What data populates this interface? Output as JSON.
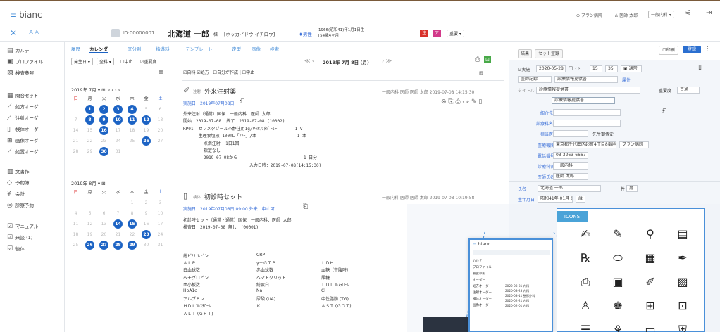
{
  "app": {
    "name": "bianc"
  },
  "topbar": {
    "right_items": [
      "プラン病院",
      "医師 太郎",
      "一般内科"
    ],
    "menu_glyph": "⚟",
    "logout_glyph": "⇥"
  },
  "patient": {
    "id": "ID:00000001",
    "name": "北海道 一郎",
    "honorific": "様",
    "kana": "[ホッカイドウ イチロウ]",
    "sex": "男性",
    "birth": "1966(昭和41)年1月1日生",
    "age": "[54歳4ヶ月]",
    "status": "重要"
  },
  "sidebar": {
    "items": [
      {
        "icon": "▤",
        "label": "カルテ"
      },
      {
        "icon": "▣",
        "label": "プロファイル"
      },
      {
        "icon": "▧",
        "label": "検査参照"
      },
      {
        "icon": "▦",
        "label": "問合セット"
      },
      {
        "icon": "⟋",
        "label": "処方オーダ"
      },
      {
        "icon": "⟋",
        "label": "注射オーダ"
      },
      {
        "icon": "▯",
        "label": "検体オーダ"
      },
      {
        "icon": "⊞",
        "label": "画像オーダ"
      },
      {
        "icon": "⟋",
        "label": "処置オーダ"
      },
      {
        "icon": "▥",
        "label": "文書作"
      },
      {
        "icon": "◇",
        "label": "予約簿"
      },
      {
        "icon": "¥",
        "label": "会計"
      },
      {
        "icon": "◎",
        "label": "診察予約"
      },
      {
        "icon": "☑",
        "label": "マニュアル"
      },
      {
        "icon": "☑",
        "label": "来談 (1)"
      },
      {
        "icon": "☑",
        "label": "後体"
      }
    ]
  },
  "tabs": [
    "履歴",
    "カレンダ",
    "区分別",
    "指導料",
    "テンプレート",
    "定型",
    "画像",
    "検索"
  ],
  "filters": {
    "date_mode": "発生日",
    "dept": "全科",
    "cb1": "中止",
    "cb2": "重要度"
  },
  "calendar": {
    "july_title": "2019年 7月",
    "aug_title": "2019年 8月",
    "weekdays": [
      "日",
      "月",
      "火",
      "水",
      "木",
      "金",
      "土"
    ],
    "july": [
      "",
      "1",
      "2",
      "3",
      "4",
      "5",
      "6",
      "7",
      "8",
      "9",
      "10",
      "11",
      "12",
      "13",
      "14",
      "15",
      "16",
      "17",
      "18",
      "19",
      "20",
      "21",
      "22",
      "23",
      "24",
      "25",
      "26",
      "27",
      "28",
      "29",
      "30",
      "31"
    ],
    "july_selected": [
      "1",
      "2",
      "3",
      "4",
      "8",
      "9",
      "10",
      "11",
      "12",
      "16",
      "26",
      "30"
    ],
    "aug": [
      "",
      "",
      "",
      "",
      "1",
      "2",
      "3",
      "4",
      "5",
      "6",
      "7",
      "8",
      "9",
      "10",
      "11",
      "12",
      "13",
      "14",
      "15",
      "16",
      "17",
      "18",
      "19",
      "20",
      "21",
      "22",
      "23",
      "24",
      "25",
      "26",
      "27",
      "28",
      "29",
      "30",
      "31"
    ],
    "aug_selected": [
      "14",
      "15",
      "23",
      "26",
      "27",
      "28",
      "29"
    ]
  },
  "records_header": {
    "dashes": "- - - - - - - -",
    "date": "2019年 7月 8日 (月)",
    "checks": [
      "自科",
      "処方",
      "自分が作成",
      "中止"
    ]
  },
  "record1": {
    "title": "外来注射薬",
    "title_prefix": "注射",
    "meta": "一般内科 医師 医師 太郎 2019-07-08 14:15:30",
    "impl": "実施日：2019年07月08日",
    "lines": [
      "外来注射（通常）国保　一般内科：医師 太郎",
      "開始：2019-07-08  終了：2019-07-08 (10002)",
      "RP01  セフメタゾール※静注用1g/V<ｾﾌﾒﾀｿﾞｰﾙ>       1 V",
      "      生理食塩液 100mL「ﾌｿｰ」/本                1 本",
      "        点滴注射  1日1回",
      "        指定なし",
      "        2019-07-08から                          1 日分",
      "                          入力日時：2019-07-08(14:15:30)"
    ]
  },
  "record2": {
    "title": "初診時セット",
    "title_prefix": "検体",
    "meta": "一般内科 医師 医師 太郎 2019-07-08 10:19:58",
    "impl": "実施日：2019年07月08日 09:00 外来：中止可",
    "lines": [
      "初診時セット（通常・通常）国保　一般内科：医師 太郎",
      "検査日：2019-07-08 無し　(00001)"
    ],
    "table": [
      [
        "総ビリルビン",
        "CRP",
        ""
      ],
      [
        "ＡＬＰ",
        "γ－ＧＴＰ",
        "ＬＤＨ"
      ],
      [
        "白血球数",
        "赤血球数",
        "血糖（空腹時）"
      ],
      [
        "ヘモグロビン",
        "ヘマトクリット",
        "尿糖"
      ],
      [
        "血小板数",
        "総蛋白",
        "ＬＤＬｺﾚｽﾃﾛｰﾙ"
      ],
      [
        "HbA1c",
        "Na",
        "Cl"
      ],
      [
        "アルブミン",
        "尿酸 (UA)",
        "中性脂肪 (TG)"
      ],
      [
        "ＨＤＬｺﾚｽﾃﾛｰﾙ",
        "Ｋ",
        "ＡＳＴ (ＧＯＴ)"
      ],
      [
        "ＡＬＴ (ＧＰＴ)",
        "",
        ""
      ]
    ]
  },
  "right_panel": {
    "tabs": [
      "結果",
      "セット登録"
    ],
    "print": "印刷",
    "register": "登録",
    "status_label": "実施",
    "date": "2020-05-28",
    "time": [
      "15",
      "35"
    ],
    "flag": "通常",
    "type1": "医師記録",
    "type2": "診療情報提供書",
    "sub": "属性",
    "title_label": "タイトル",
    "title_value": "診療情報提供書",
    "importance_label": "重要度",
    "importance": "普通",
    "doc_title": "診療情報提供書",
    "labels": [
      "紹介先",
      "診療科名",
      "担当医",
      "医療機関",
      "電話番号",
      "診療科名",
      "医師氏名",
      "氏名",
      "生年月日"
    ],
    "values": [
      "",
      "",
      "先生御侍史",
      "東京都千代田区超町4丁目8番地",
      "03-3263-6667",
      "一般内科",
      "医師 太郎",
      "北海道 一郎",
      "昭和41年 01月 01日"
    ],
    "clinic": "プラン病院",
    "sex_label": "性",
    "sex_value": "男",
    "age_suffix": "歳"
  },
  "icons_panel": {
    "title": "ICONS",
    "icons": [
      [
        "pen-write-icon",
        "✍"
      ],
      [
        "pencil-icon",
        "✎"
      ],
      [
        "person-icon",
        "⚲"
      ],
      [
        "document-icon",
        "▤"
      ],
      [
        "medicine-icon",
        "℞"
      ],
      [
        "pill-icon",
        "⬭"
      ],
      [
        "report-icon",
        "▦"
      ],
      [
        "quill-icon",
        "✒"
      ],
      [
        "printer-icon",
        "⎙"
      ],
      [
        "monitor-icon",
        "▣"
      ],
      [
        "edit-doc-icon",
        "✐"
      ],
      [
        "image-icon",
        "▨"
      ],
      [
        "user-icon",
        "♙"
      ],
      [
        "users-icon",
        "♚"
      ],
      [
        "chart-icon",
        "⊞"
      ],
      [
        "lock-doc-icon",
        "⊡"
      ],
      [
        "list-icon",
        "☰"
      ],
      [
        "tree-icon",
        "⚘"
      ],
      [
        "folder-icon",
        "▭"
      ],
      [
        "shield-icon",
        "⛨"
      ]
    ]
  },
  "mini_screenshot": {
    "app": "bianc",
    "sidebar": [
      "カルテ",
      "プロファイル",
      "検査参照",
      "オーダー",
      "処方オーダー",
      "注射オーダー",
      "検体オーダー",
      "画像オーダー"
    ],
    "rows": [
      "2020-03-31 内科",
      "2020-03-23 内科",
      "2020-03-11 整形外科",
      "2020-02-21 内科",
      "2020-02-01 内科"
    ]
  }
}
